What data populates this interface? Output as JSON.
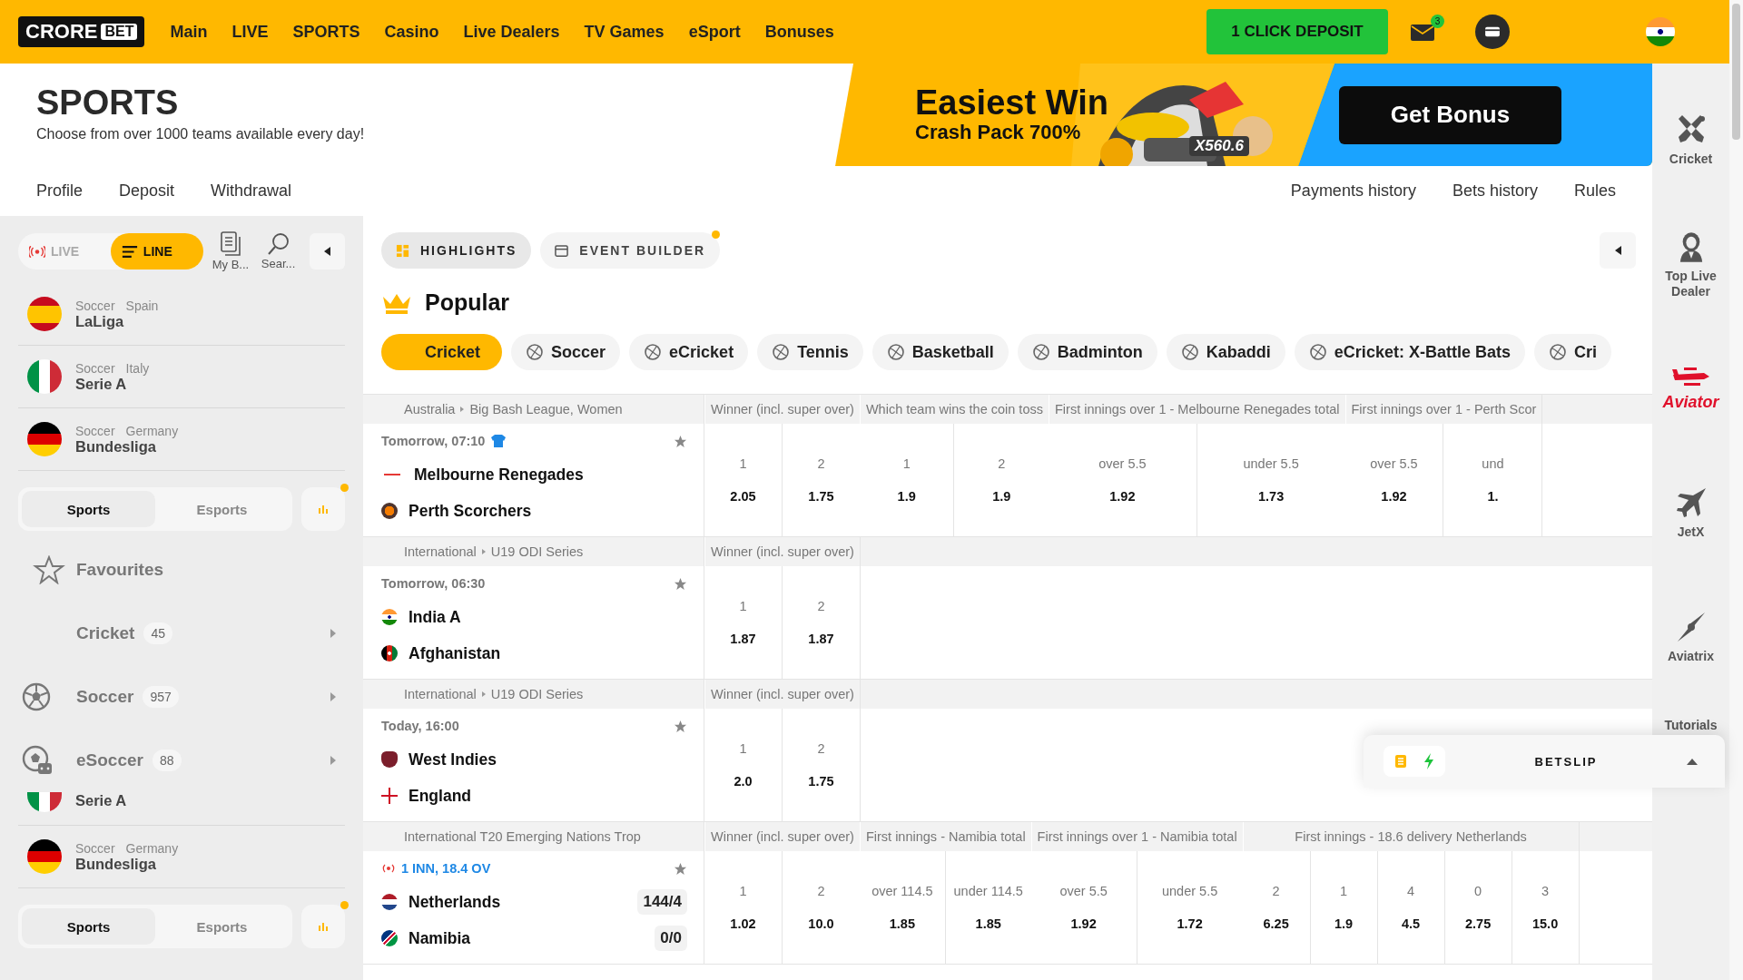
{
  "header": {
    "logo": [
      "CRORE",
      "BET"
    ],
    "nav": [
      "Main",
      "LIVE",
      "SPORTS",
      "Casino",
      "Live Dealers",
      "TV Games",
      "eSport",
      "Bonuses"
    ],
    "deposit_button": "1 CLICK DEPOSIT",
    "mail_badge": "3"
  },
  "page": {
    "title": "SPORTS",
    "subtitle": "Choose from over 1000 teams available every day!"
  },
  "banner": {
    "headline": "Easiest Win",
    "subline": "Crash Pack 700%",
    "multiplier": "X560.6",
    "button": "Get Bonus"
  },
  "account_links": [
    "Profile",
    "Deposit",
    "Withdrawal"
  ],
  "history_links": [
    "Payments history",
    "Bets history",
    "Rules"
  ],
  "sidebar": {
    "mode_tabs": [
      {
        "label": "LIVE",
        "kind": "live",
        "selected": false
      },
      {
        "label": "LINE",
        "kind": "line",
        "selected": true
      }
    ],
    "tools": [
      {
        "label": "My B...",
        "kind": "bets"
      },
      {
        "label": "Sear...",
        "kind": "search"
      }
    ],
    "items": [
      {
        "kind": "league",
        "sport": "Soccer",
        "country": "Spain",
        "name": "LaLiga"
      },
      {
        "kind": "league",
        "sport": "Soccer",
        "country": "Italy",
        "name": "Serie A"
      },
      {
        "kind": "league",
        "sport": "Soccer",
        "country": "Germany",
        "name": "Bundesliga"
      },
      {
        "kind": "switch",
        "dot": true,
        "options": [
          {
            "label": "Sports",
            "selected": true
          },
          {
            "label": "Esports",
            "selected": false
          }
        ]
      },
      {
        "kind": "favourites",
        "label": "Favourites"
      },
      {
        "kind": "sport",
        "label": "Cricket",
        "count": "45"
      },
      {
        "kind": "sport",
        "label": "Soccer",
        "count": "957"
      },
      {
        "kind": "sport",
        "label": "eSoccer",
        "count": "88"
      },
      {
        "kind": "league",
        "name": "Serie A"
      },
      {
        "kind": "league",
        "sport": "Soccer",
        "country": "Germany",
        "name": "Bundesliga"
      },
      {
        "kind": "switch",
        "dot": true,
        "options": [
          {
            "label": "Sports",
            "selected": true
          },
          {
            "label": "Esports",
            "selected": false
          }
        ]
      }
    ]
  },
  "main": {
    "view_tabs": [
      {
        "label": "HIGHLIGHTS",
        "selected": true,
        "dot": false
      },
      {
        "label": "EVENT BUILDER",
        "selected": false,
        "dot": true
      }
    ],
    "section_title": "Popular",
    "sports": [
      {
        "label": "Cricket",
        "selected": true
      },
      {
        "label": "Soccer",
        "selected": false
      },
      {
        "label": "eCricket",
        "selected": false
      },
      {
        "label": "Tennis",
        "selected": false
      },
      {
        "label": "Basketball",
        "selected": false
      },
      {
        "label": "Badminton",
        "selected": false
      },
      {
        "label": "Kabaddi",
        "selected": false
      },
      {
        "label": "eCricket: X-Battle Bats",
        "selected": false
      },
      {
        "label": "Cri",
        "selected": false
      }
    ],
    "events": [
      {
        "league": [
          "Australia",
          "Big Bash League, Women"
        ],
        "kind": "scheduled",
        "time": "Tomorrow, 07:10",
        "teams": [
          {
            "name": "Melbourne Renegades"
          },
          {
            "name": "Perth Scorchers"
          }
        ],
        "markets": [
          {
            "title": "Winner (incl. super over)",
            "outcomes": [
              {
                "label": "1",
                "odds": "2.05"
              },
              {
                "label": "2",
                "odds": "1.75"
              }
            ]
          },
          {
            "title": "Which team wins the coin toss",
            "outcomes": [
              {
                "label": "1",
                "odds": "1.9"
              },
              {
                "label": "2",
                "odds": "1.9"
              }
            ]
          },
          {
            "title": "First innings over 1 - Melbourne Renegades total",
            "outcomes": [
              {
                "label": "over 5.5",
                "odds": "1.92"
              },
              {
                "label": "under 5.5",
                "odds": "1.73"
              }
            ]
          },
          {
            "title": "First innings over 1 - Perth Scor",
            "outcomes": [
              {
                "label": "over 5.5",
                "odds": "1.92"
              },
              {
                "label": "und",
                "odds": "1."
              }
            ]
          }
        ]
      },
      {
        "league": [
          "International",
          "U19 ODI Series"
        ],
        "kind": "scheduled",
        "time": "Tomorrow, 06:30",
        "teams": [
          {
            "name": "India A"
          },
          {
            "name": "Afghanistan"
          }
        ],
        "markets": [
          {
            "title": "Winner (incl. super over)",
            "outcomes": [
              {
                "label": "1",
                "odds": "1.87"
              },
              {
                "label": "2",
                "odds": "1.87"
              }
            ]
          }
        ]
      },
      {
        "league": [
          "International",
          "U19 ODI Series"
        ],
        "kind": "scheduled",
        "time": "Today, 16:00",
        "teams": [
          {
            "name": "West Indies"
          },
          {
            "name": "England"
          }
        ],
        "markets": [
          {
            "title": "Winner (incl. super over)",
            "outcomes": [
              {
                "label": "1",
                "odds": "2.0"
              },
              {
                "label": "2",
                "odds": "1.75"
              }
            ]
          }
        ]
      },
      {
        "league": [
          "International T20 Emerging Nations Trop"
        ],
        "kind": "live",
        "time": "1 INN, 18.4 OV",
        "teams": [
          {
            "name": "Netherlands",
            "score": "144/4"
          },
          {
            "name": "Namibia",
            "score": "0/0"
          }
        ],
        "markets": [
          {
            "title": "Winner (incl. super over)",
            "outcomes": [
              {
                "label": "1",
                "odds": "1.02"
              },
              {
                "label": "2",
                "odds": "10.0"
              }
            ]
          },
          {
            "title": "First innings - Namibia total",
            "outcomes": [
              {
                "label": "over 114.5",
                "odds": "1.85"
              },
              {
                "label": "under 114.5",
                "odds": "1.85"
              }
            ]
          },
          {
            "title": "First innings over 1 - Namibia total",
            "outcomes": [
              {
                "label": "over 5.5",
                "odds": "1.92"
              },
              {
                "label": "under 5.5",
                "odds": "1.72"
              }
            ]
          },
          {
            "title": "First innings - 18.6 delivery Netherlands",
            "outcomes": [
              {
                "label": "2",
                "odds": "6.25"
              },
              {
                "label": "1",
                "odds": "1.9"
              },
              {
                "label": "4",
                "odds": "4.5"
              },
              {
                "label": "0",
                "odds": "2.75"
              },
              {
                "label": "3",
                "odds": "15.0"
              }
            ]
          }
        ]
      }
    ]
  },
  "rail": [
    {
      "label": "Cricket",
      "kind": "cricket"
    },
    {
      "label": "Top Live Dealer",
      "kind": "dealer"
    },
    {
      "label": "Aviator",
      "kind": "aviator"
    },
    {
      "label": "JetX",
      "kind": "jetx"
    },
    {
      "label": "Aviatrix",
      "kind": "aviatrix"
    },
    {
      "label": "Tutorials",
      "kind": "tutorials"
    }
  ],
  "betslip": {
    "title": "BETSLIP"
  }
}
